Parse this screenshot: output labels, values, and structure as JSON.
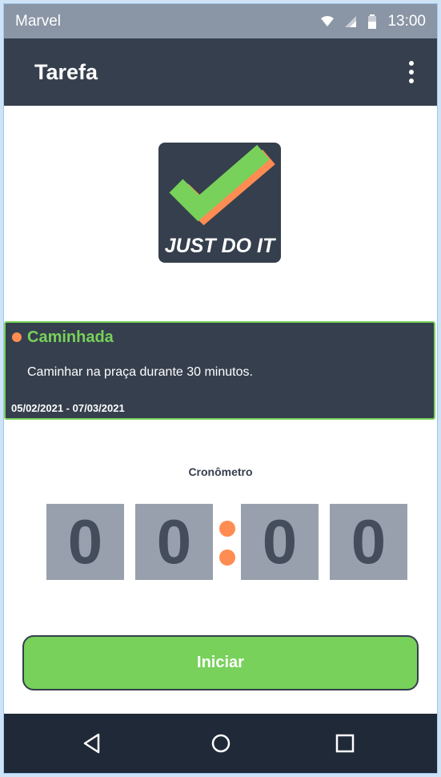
{
  "status_bar": {
    "carrier": "Marvel",
    "time": "13:00",
    "icons": [
      "wifi-icon",
      "signal-icon",
      "battery-icon"
    ]
  },
  "app_bar": {
    "title": "Tarefa",
    "menu_icon": "more-vert-icon"
  },
  "logo": {
    "text": "JUST DO IT",
    "icon": "checkmark-icon"
  },
  "task": {
    "title": "Caminhada",
    "description": "Caminhar na praça durante 30 minutos.",
    "dates": "05/02/2021 - 07/03/2021"
  },
  "timer": {
    "label": "Cronômetro",
    "digits": [
      "0",
      "0",
      "0",
      "0"
    ]
  },
  "start_button": {
    "label": "Iniciar"
  },
  "nav_bar": {
    "icons": [
      "back-icon",
      "home-icon",
      "recents-icon"
    ]
  },
  "colors": {
    "dark": "#353f4d",
    "green": "#78d15b",
    "orange": "#ff8c52",
    "digit_bg": "#98a0ad",
    "status_bar": "#8a95a5",
    "nav_bar": "#1f2937"
  }
}
